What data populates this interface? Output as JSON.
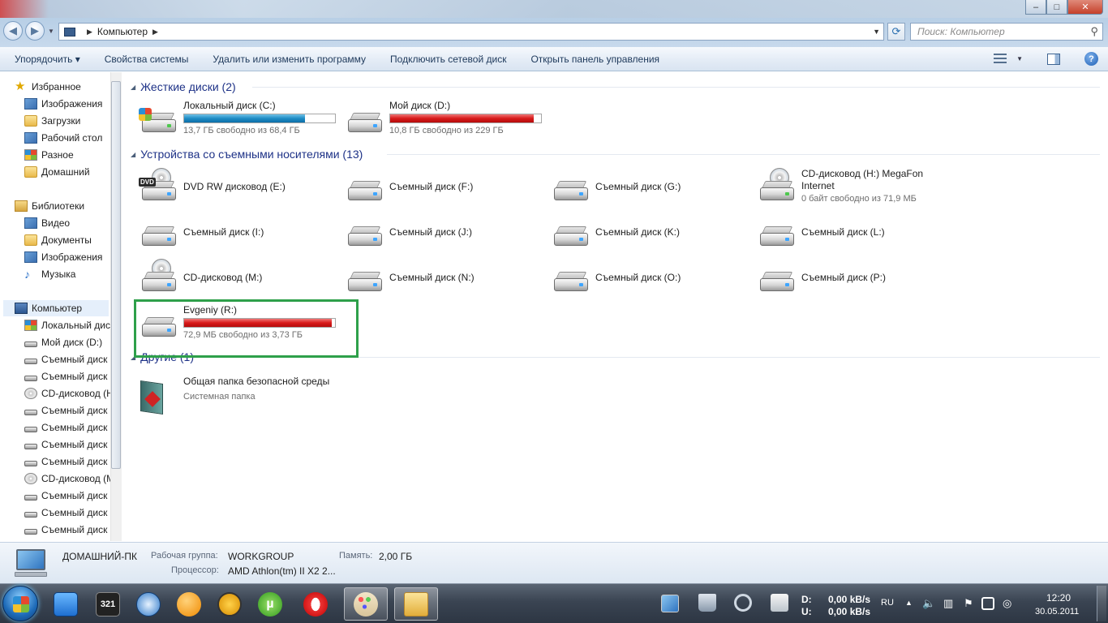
{
  "window": {
    "controls": {
      "minimize": "–",
      "maximize": "□",
      "close": "✕"
    }
  },
  "address": {
    "crumb": "Компьютер",
    "search_placeholder": "Поиск: Компьютер"
  },
  "toolbar": {
    "organize": "Упорядочить ▾",
    "system_properties": "Свойства системы",
    "uninstall": "Удалить или изменить программу",
    "map_drive": "Подключить сетевой диск",
    "control_panel": "Открыть панель управления"
  },
  "sidebar": {
    "favorites": {
      "title": "Избранное",
      "items": [
        "Изображения",
        "Загрузки",
        "Рабочий стол",
        "Разное",
        "Домашний"
      ]
    },
    "libraries": {
      "title": "Библиотеки",
      "items": [
        "Видео",
        "Документы",
        "Изображения",
        "Музыка"
      ]
    },
    "computer": {
      "title": "Компьютер",
      "items": [
        "Локальный диск",
        "Мой диск (D:)",
        "Съемный диск",
        "Съемный диск",
        "CD-дисковод (H",
        "Съемный диск",
        "Съемный диск",
        "Съемный диск",
        "Съемный диск",
        "CD-дисковод (M",
        "Съемный диск",
        "Съемный диск",
        "Съемный диск"
      ]
    }
  },
  "groups": {
    "hard_disks": "Жесткие диски (2)",
    "removable": "Устройства со съемными носителями (13)",
    "other": "Другие (1)"
  },
  "hard_disks": [
    {
      "name": "Локальный диск (C:)",
      "free": "13,7 ГБ свободно из 68,4 ГБ",
      "used_fraction": 0.8,
      "bar": "blue"
    },
    {
      "name": "Мой диск (D:)",
      "free": "10,8 ГБ свободно из 229 ГБ",
      "used_fraction": 0.953,
      "bar": "red"
    }
  ],
  "removable": [
    {
      "name": "DVD RW дисковод (E:)"
    },
    {
      "name": "Съемный диск (F:)"
    },
    {
      "name": "Съемный диск (G:)"
    },
    {
      "name": "CD-дисковод (H:) MegaFon Internet",
      "free": "0 байт свободно из 71,9 МБ"
    },
    {
      "name": "Съемный диск (I:)"
    },
    {
      "name": "Съемный диск (J:)"
    },
    {
      "name": "Съемный диск (K:)"
    },
    {
      "name": "Съемный диск (L:)"
    },
    {
      "name": "CD-дисковод (M:)"
    },
    {
      "name": "Съемный диск (N:)"
    },
    {
      "name": "Съемный диск (O:)"
    },
    {
      "name": "Съемный диск (P:)"
    },
    {
      "name": "Evgeniy (R:)",
      "free": "72,9 МБ свободно из 3,73 ГБ",
      "used_fraction": 0.981,
      "bar": "red"
    }
  ],
  "other": [
    {
      "name": "Общая папка безопасной среды",
      "sub": "Системная папка"
    }
  ],
  "details": {
    "pc_name": "ДОМАШНИЙ-ПК",
    "workgroup_label": "Рабочая группа:",
    "workgroup_value": "WORKGROUP",
    "memory_label": "Память:",
    "memory_value": "2,00 ГБ",
    "cpu_label": "Процессор:",
    "cpu_value": "AMD Athlon(tm) II X2 2..."
  },
  "taskbar": {
    "net_down_label": "D:",
    "net_down_value": "0,00 kB/s",
    "net_up_label": "U:",
    "net_up_value": "0,00 kB/s",
    "lang": "RU",
    "time": "12:20",
    "date": "30.05.2011",
    "app_321_label": "321"
  },
  "colors": {
    "accent_title": "#1e3287",
    "bar_blue": "#1f8cc4",
    "bar_red": "#d81a1a",
    "highlight_green": "#2ea04a"
  }
}
